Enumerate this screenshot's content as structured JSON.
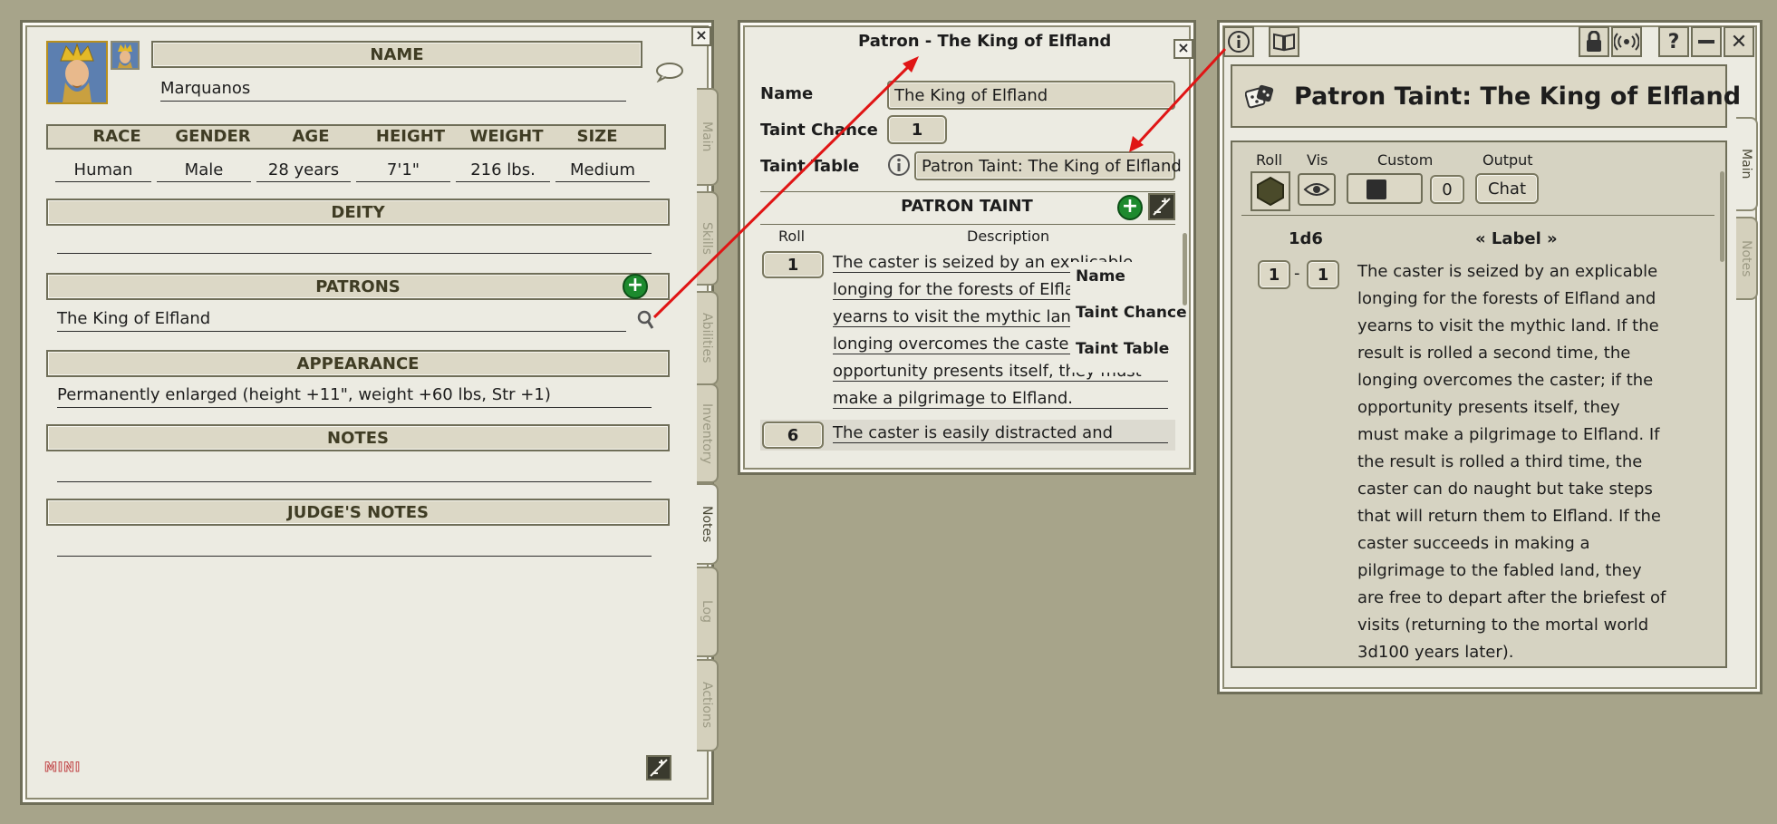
{
  "charsheet": {
    "name_header": "NAME",
    "name_value": "Marquanos",
    "stat_headers": [
      "RACE",
      "GENDER",
      "AGE",
      "HEIGHT",
      "WEIGHT",
      "SIZE"
    ],
    "stat_values": [
      "Human",
      "Male",
      "28 years",
      "7'1\"",
      "216 lbs.",
      "Medium"
    ],
    "deity_header": "DEITY",
    "deity_value": "",
    "patrons_header": "PATRONS",
    "patron_value": "The King of Elfland",
    "appearance_header": "APPEARANCE",
    "appearance_value": "Permanently enlarged (height +11\", weight +60 lbs, Str +1)",
    "notes_header": "NOTES",
    "notes_value": "",
    "judges_notes_header": "JUDGE'S NOTES",
    "judges_notes_value": "",
    "mini_label": "MINI",
    "tabs": [
      "Main",
      "Skills",
      "Abilities",
      "Inventory",
      "Notes",
      "Log",
      "Actions"
    ],
    "active_tab": "Notes"
  },
  "patron_window": {
    "title": "Patron - The King of Elfland",
    "name_label": "Name",
    "name_value": "The King of Elfland",
    "taint_chance_label": "Taint Chance",
    "taint_chance_value": "1",
    "taint_table_label": "Taint Table",
    "taint_table_value": "Patron Taint: The King of Elfland",
    "section_header": "PATRON TAINT",
    "col_roll": "Roll",
    "col_description": "Description",
    "rows": [
      {
        "roll": "1",
        "lines": [
          "The caster is seized by an explicable",
          "longing for the forests of Elflan",
          "yearns to visit the mythic land.",
          "longing overcomes the caster;",
          "opportunity presents itself, they must",
          "make a pilgrimage to Elfland."
        ]
      },
      {
        "roll": "6",
        "lines": [
          "The caster is easily distracted and"
        ]
      }
    ],
    "overlay_labels": [
      "Name",
      "Taint Chance",
      "Taint Table"
    ]
  },
  "taint_window": {
    "title": "Patron Taint: The King of Elfland",
    "col_roll": "Roll",
    "col_vis": "Vis",
    "col_custom": "Custom",
    "col_output": "Output",
    "custom_value": "0",
    "output_value": "Chat",
    "dice": "1d6",
    "label_header": "« Label »",
    "range_from": "1",
    "range_sep": "-",
    "range_to": "1",
    "text_lines": [
      "The caster is seized by an explicable",
      "longing for the forests of Elfland and",
      "yearns to visit the mythic land. If the",
      "result is rolled a second time, the",
      "longing overcomes the caster; if the",
      "opportunity presents itself, they",
      "must make a pilgrimage to Elfland. If",
      "the result is rolled a third time, the",
      "caster can do naught but take steps",
      "that will return them to Elfland. If the",
      "caster succeeds in making a",
      "pilgrimage to the fabled land, they",
      "are free to depart after the briefest of",
      "visits (returning to the mortal world",
      "3d100 years later)."
    ],
    "tabs": [
      "Main",
      "Notes"
    ]
  },
  "icons": {
    "close": "close-icon",
    "info": "info-icon",
    "book": "book-icon",
    "lock": "lock-icon",
    "broadcast": "broadcast-icon",
    "help": "help-icon",
    "minimize": "minimize-icon",
    "dice": "dice-icon",
    "eye": "eye-icon",
    "add": "add-icon",
    "edit": "edit-icon",
    "search": "search-icon",
    "speech": "speech-bubble-icon"
  },
  "colors": {
    "background": "#a7a48a",
    "panel": "#ecebe2",
    "header": "#dcd8c6",
    "arrow": "#e01515",
    "add_button": "#1d8a2e"
  }
}
